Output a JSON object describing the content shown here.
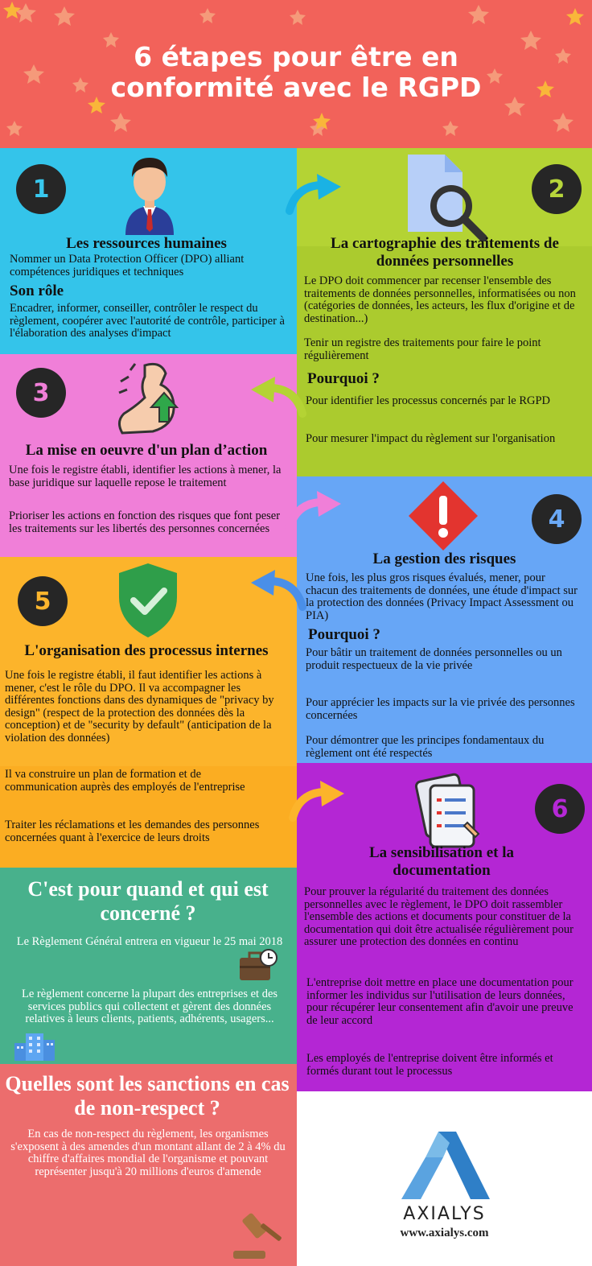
{
  "header": {
    "title": "6 étapes pour être en conformité avec le RGPD"
  },
  "step1": {
    "number": "1",
    "title": "Les ressources humaines",
    "intro": "Nommer un Data Protection Officer (DPO) alliant compétences juridiques et techniques",
    "subtitle": "Son rôle",
    "text": "Encadrer, informer, conseiller, contrôler le respect du règlement, coopérer avec l'autorité de contrôle, participer à l'élaboration des analyses d'impact"
  },
  "step2": {
    "number": "2",
    "title": "La cartographie des traitements de données personnelles",
    "p1": "Le DPO doit commencer par recenser l'ensemble des traitements de données personnelles, informatisées ou non (catégories de données, les acteurs, les flux d'origine et de destination...)",
    "p2": "Tenir un registre des traitements pour faire le point régulièrement",
    "subtitle": "Pourquoi ?",
    "p3": "Pour identifier les processus concernés par le RGPD",
    "p4": "Pour mesurer l'impact du règlement sur l'organisation"
  },
  "step3": {
    "number": "3",
    "title": "La mise en oeuvre d'un plan d’action",
    "p1": "Une fois le registre établi, identifier les actions à mener, la base juridique sur laquelle repose le traitement",
    "p2": "Prioriser les actions en fonction des risques  que font peser les traitements sur les libertés des personnes concernées"
  },
  "step4": {
    "number": "4",
    "title": "La gestion des risques",
    "p1": "Une fois, les plus gros risques évalués,  mener, pour chacun des traitements de données, une étude d'impact sur la protection des données (Privacy Impact Assessment ou PIA)",
    "subtitle": "Pourquoi ?",
    "p2": "Pour bâtir un traitement de données personnelles ou un produit respectueux de la vie privée",
    "p3": "Pour apprécier les impacts sur la vie privée des personnes concernées",
    "p4": "Pour démontrer que les principes fondamentaux du règlement ont été respectés"
  },
  "step5": {
    "number": "5",
    "title": "L'organisation des processus internes",
    "p1": "Une fois le registre établi, il faut identifier les actions à mener, c'est le rôle du DPO. Il va accompagner les différentes fonctions dans des dynamiques de \"privacy by design\" (respect de la protection des données dès la conception) et de \"security by default\" (anticipation de la violation des données)",
    "p2": "Il va construire un plan de formation et de communication auprès des employés de l'entreprise",
    "p3": "Traiter les réclamations et les demandes des personnes concernées quant à l'exercice de leurs droits"
  },
  "step6": {
    "number": "6",
    "title": "La sensibilisation et la documentation",
    "p1": "Pour prouver la régularité du traitement des données personnelles avec le règlement, le DPO doit rassembler l'ensemble des actions et documents pour constituer de la documentation qui doit être actualisée régulièrement pour assurer une protection des données en continu",
    "p2": "L'entreprise doit mettre en place une documentation pour informer les individus sur l'utilisation de leurs données, pour récupérer leur consentement afin d'avoir une preuve de leur accord",
    "p3": " Les employés de l'entreprise doivent être informés et formés durant tout le processus"
  },
  "when": {
    "title": "C'est pour quand et qui est concerné ?",
    "p1": "Le Règlement Général entrera en vigueur le 25 mai 2018",
    "p2": "Le règlement concerne la plupart des entreprises et des services publics qui collectent et gèrent des données relatives à leurs clients, patients, adhérents, usagers..."
  },
  "sanctions": {
    "title": "Quelles sont les sanctions en cas de non-respect ?",
    "text": "En cas de non-respect du règlement, les organismes s'exposent à des amendes d'un montant allant de 2 à 4% du chiffre d'affaires mondial de l'organisme et pouvant représenter jusqu'à 20 millions d'euros d'amende"
  },
  "brand": {
    "name": "AXIALYS",
    "url": "www.axialys.com"
  },
  "colors": {
    "header": "#f2625a",
    "step1": "#34c4ea",
    "step2": "#b4d334",
    "step3": "#f07fd8",
    "step4": "#67a6f6",
    "step5": "#fcb42b",
    "step6": "#b426d4",
    "when": "#48b18c",
    "sanctions": "#ec6d6d"
  },
  "icons": [
    "person-icon",
    "document-search-icon",
    "flexed-arm-icon",
    "warning-icon",
    "shield-check-icon",
    "documents-icon",
    "briefcase-clock-icon",
    "buildings-icon",
    "gavel-icon",
    "arrow-icon",
    "axialys-logo"
  ]
}
